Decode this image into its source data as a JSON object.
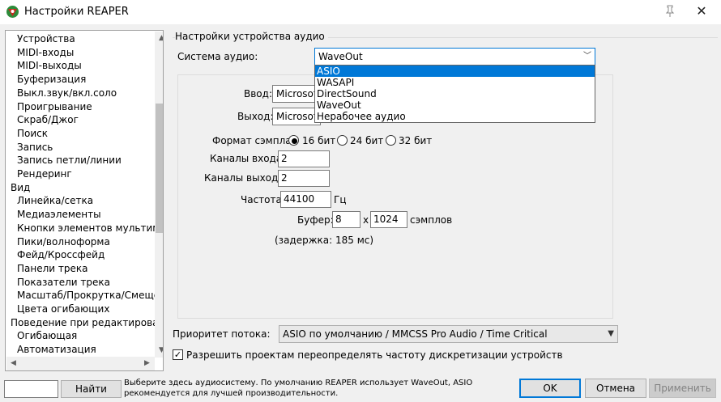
{
  "window": {
    "title": "Настройки REAPER",
    "close_glyph": "✕"
  },
  "tree": {
    "items": [
      {
        "label": "Устройства",
        "indent": 1,
        "selected": true
      },
      {
        "label": "MIDI-входы",
        "indent": 1
      },
      {
        "label": "MIDI-выходы",
        "indent": 1
      },
      {
        "label": "Буферизация",
        "indent": 1
      },
      {
        "label": "Выкл.звук/вкл.соло",
        "indent": 1
      },
      {
        "label": "Проигрывание",
        "indent": 1
      },
      {
        "label": "Скраб/Джог",
        "indent": 1
      },
      {
        "label": "Поиск",
        "indent": 1
      },
      {
        "label": "Запись",
        "indent": 1
      },
      {
        "label": "Запись петли/линии",
        "indent": 1
      },
      {
        "label": "Рендеринг",
        "indent": 1
      },
      {
        "label": "Вид",
        "indent": 0
      },
      {
        "label": "Линейка/сетка",
        "indent": 1
      },
      {
        "label": "Медиаэлементы",
        "indent": 1
      },
      {
        "label": "Кнопки элементов мультимедиа",
        "indent": 1
      },
      {
        "label": "Пики/волноформа",
        "indent": 1
      },
      {
        "label": "Фейд/Кроссфейд",
        "indent": 1
      },
      {
        "label": "Панели трека",
        "indent": 1
      },
      {
        "label": "Показатели трека",
        "indent": 1
      },
      {
        "label": "Масштаб/Прокрутка/Смещение",
        "indent": 1
      },
      {
        "label": "Цвета огибающих",
        "indent": 1
      },
      {
        "label": "Поведение при редактировании",
        "indent": 0
      },
      {
        "label": "Огибающая",
        "indent": 1
      },
      {
        "label": "Автоматизация",
        "indent": 1
      }
    ],
    "scroll_up": "▲",
    "scroll_down": "▼",
    "scroll_left": "◀",
    "scroll_right": "▶"
  },
  "section_title": "Настройки устройства аудио",
  "audio_system": {
    "label": "Система аудио:",
    "value": "WaveOut",
    "options": [
      "ASIO",
      "WASAPI",
      "DirectSound",
      "WaveOut",
      "Нерабочее аудио"
    ],
    "highlighted": "ASIO"
  },
  "device": {
    "input_label": "Ввод:",
    "input_value": "Microsoft",
    "output_label": "Выход:",
    "output_value": "Microsoft"
  },
  "format": {
    "label": "Формат сэмпла:",
    "options": [
      {
        "label": "16 бит",
        "checked": true
      },
      {
        "label": "24 бит",
        "checked": false
      },
      {
        "label": "32 бит",
        "checked": false
      }
    ]
  },
  "channels": {
    "in_label": "Каналы входа:",
    "in_value": "2",
    "out_label": "Каналы выхода:",
    "out_value": "2"
  },
  "rate": {
    "label": "Частота",
    "value": "44100",
    "unit": "Гц"
  },
  "buffer": {
    "label": "Буфер:",
    "count": "8",
    "times": "x",
    "size": "1024",
    "unit": "сэмплов"
  },
  "latency": "(задержка: 185 мс)",
  "priority": {
    "label": "Приоритет потока:",
    "value": "ASIO по умолчанию / MMCSS Pro Audio / Time Critical"
  },
  "override": {
    "label": "Разрешить проектам переопределять частоту дискретизации устройств",
    "checked": true,
    "check_glyph": "✓"
  },
  "footer": {
    "search_value": "",
    "find_button": "Найти",
    "hint": "Выберите здесь аудиосистему. По умолчанию REAPER использует WaveOut, ASIO рекомендуется для лучшей производительности.",
    "ok": "OK",
    "cancel": "Отмена",
    "apply": "Применить"
  },
  "colors": {
    "accent": "#0078d7",
    "logo_red": "#c8281e",
    "logo_green": "#2e8b3a"
  },
  "icons": {
    "app": "reaper-logo-icon",
    "pin": "pin-icon",
    "close": "close-icon",
    "dropdown": "chevron-down-icon"
  }
}
